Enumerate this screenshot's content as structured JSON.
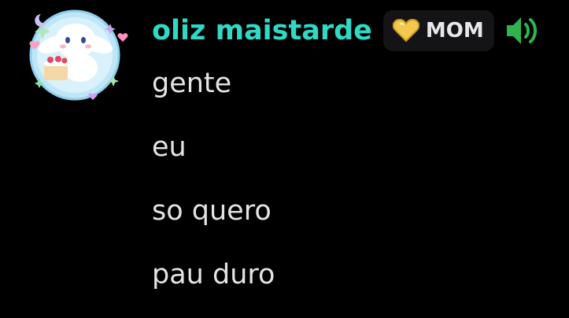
{
  "author": {
    "name": "oliz maistarde",
    "name_color": "#2fd9c6",
    "avatar_icon": "bunny-avatar-icon",
    "role_tag": {
      "icon": "gold-heart-icon",
      "label": "MOM"
    },
    "status_icon": "speaker-icon"
  },
  "messages": [
    {
      "text": "gente"
    },
    {
      "text": "eu"
    },
    {
      "text": "so quero"
    },
    {
      "text": "pau duro"
    }
  ],
  "colors": {
    "background": "#000000",
    "text": "#e4e4e6",
    "role_tag_bg": "#141416",
    "speaker_green": "#2fb34f"
  }
}
